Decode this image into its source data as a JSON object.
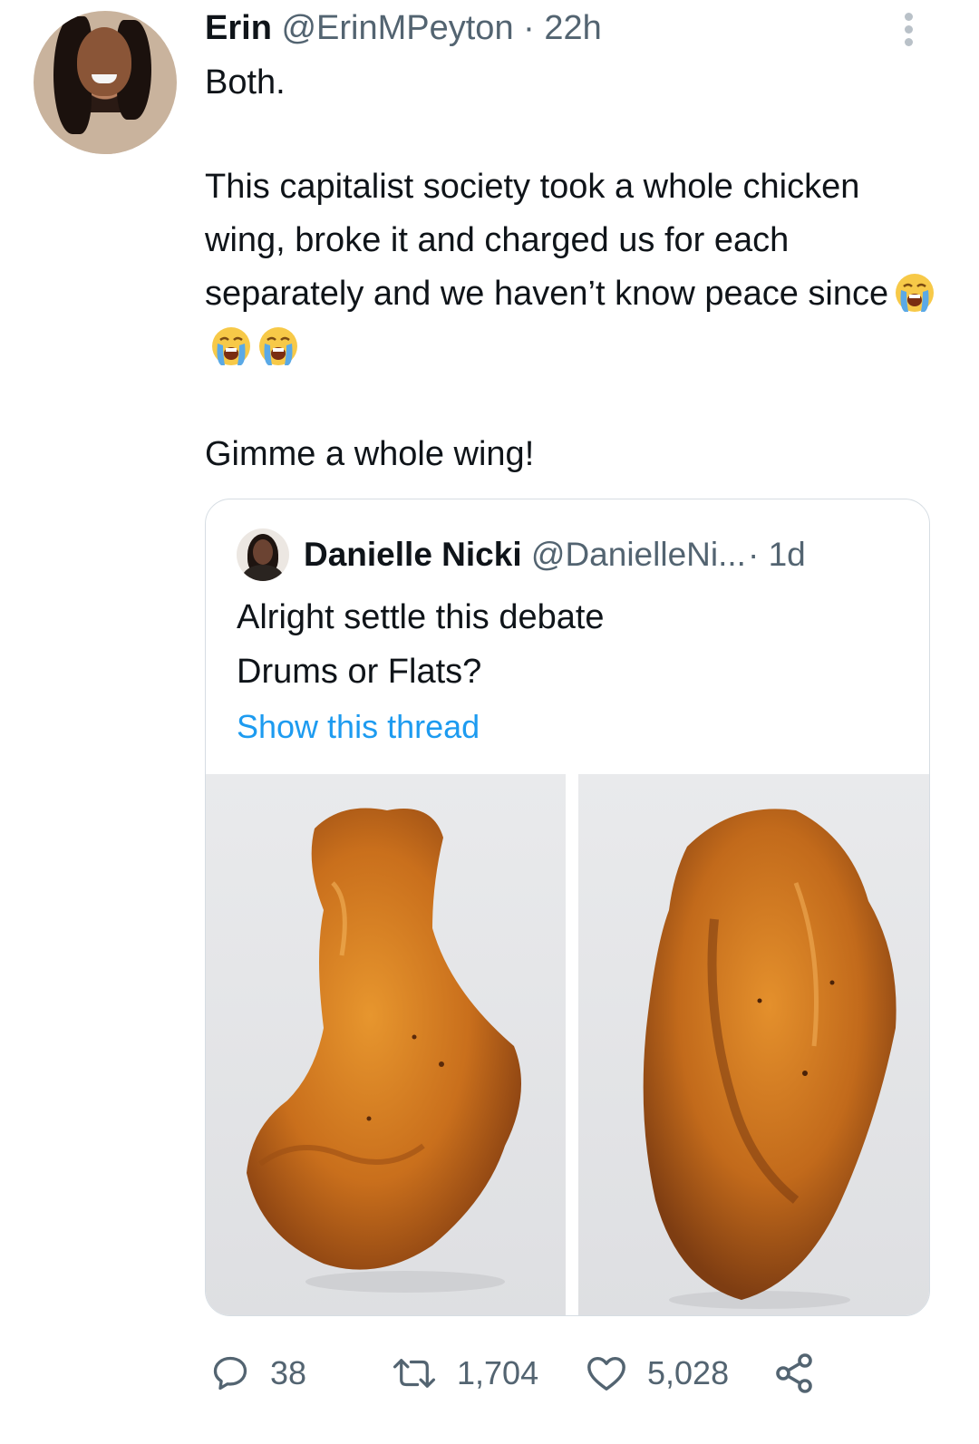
{
  "tweet": {
    "author_name": "Erin",
    "author_handle": "@ErinMPeyton",
    "separator": "·",
    "time": "22h",
    "text_line1": "Both.",
    "text_para2": "This capitalist society took a whole chicken wing, broke it and charged us for each separately and we haven’t know peace since",
    "emoji": [
      "😭",
      "😭",
      "😭"
    ],
    "text_para3": "Gimme a whole wing!"
  },
  "quote": {
    "author_name": "Danielle Nicki",
    "author_handle": "@DanielleNi...",
    "time": "· 1d",
    "line1": "Alright settle this debate",
    "line2": "Drums or Flats?",
    "show_thread": "Show this thread",
    "images": [
      "drumette-photo",
      "flat-photo"
    ]
  },
  "actions": {
    "replies": "38",
    "retweets": "1,704",
    "likes": "5,028"
  },
  "icons": [
    "more-icon",
    "reply-icon",
    "retweet-icon",
    "like-icon",
    "share-icon"
  ],
  "colors": {
    "link": "#1d9bf0",
    "secondary_text": "#536471",
    "border": "#d6dde3"
  }
}
